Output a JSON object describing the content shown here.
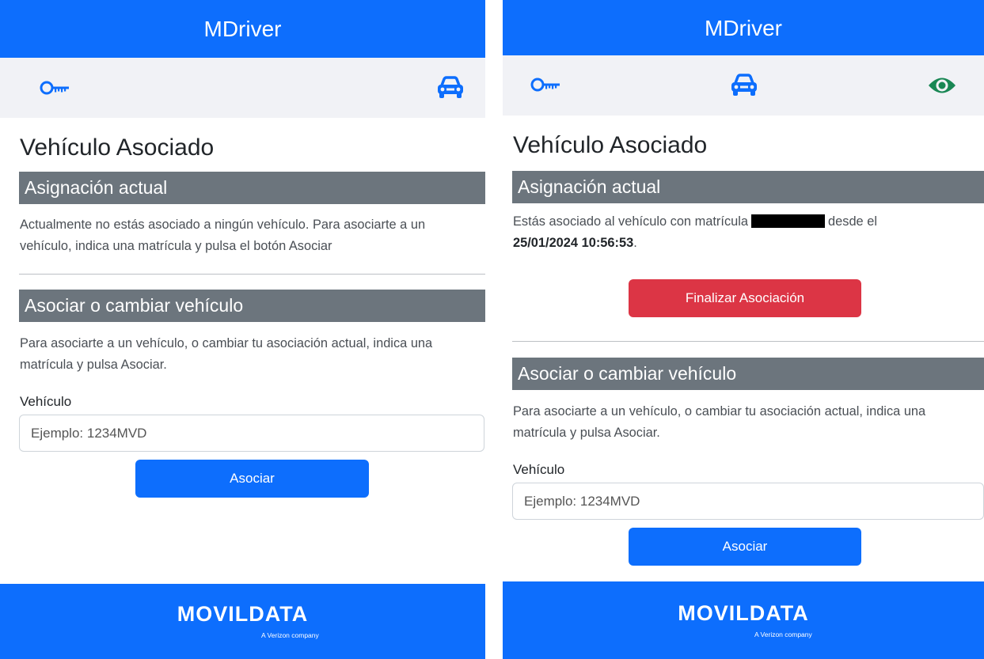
{
  "app": {
    "title": "MDriver"
  },
  "colors": {
    "primary": "#0d6efd",
    "danger": "#dc3545",
    "section": "#6c757d",
    "nav_bg": "#f1f2f6",
    "eye_icon": "#198754"
  },
  "icons": {
    "key": "key-icon",
    "car": "car-icon",
    "eye": "eye-icon"
  },
  "left": {
    "page_title": "Vehículo Asociado",
    "current": {
      "header": "Asignación actual",
      "text": "Actualmente no estás asociado a ningún vehículo. Para asociarte a un vehículo, indica una matrícula y pulsa el botón Asociar"
    },
    "associate": {
      "header": "Asociar o cambiar vehículo",
      "text": "Para asociarte a un vehículo, o cambiar tu asociación actual, indica una matrícula y pulsa Asociar.",
      "field_label": "Vehículo",
      "placeholder": "Ejemplo: 1234MVD",
      "button": "Asociar"
    }
  },
  "right": {
    "page_title": "Vehículo Asociado",
    "current": {
      "header": "Asignación actual",
      "text_before": "Estás asociado al vehículo con matrícula",
      "text_after": "desde el",
      "datetime": "25/01/2024 10:56:53",
      "suffix": ".",
      "end_button": "Finalizar Asociación"
    },
    "associate": {
      "header": "Asociar o cambiar vehículo",
      "text": "Para asociarte a un vehículo, o cambiar tu asociación actual, indica una matrícula y pulsa Asociar.",
      "field_label": "Vehículo",
      "placeholder": "Ejemplo: 1234MVD",
      "button": "Asociar"
    }
  },
  "footer": {
    "brand": "MOVILDATA",
    "tagline": "A Verizon company"
  }
}
